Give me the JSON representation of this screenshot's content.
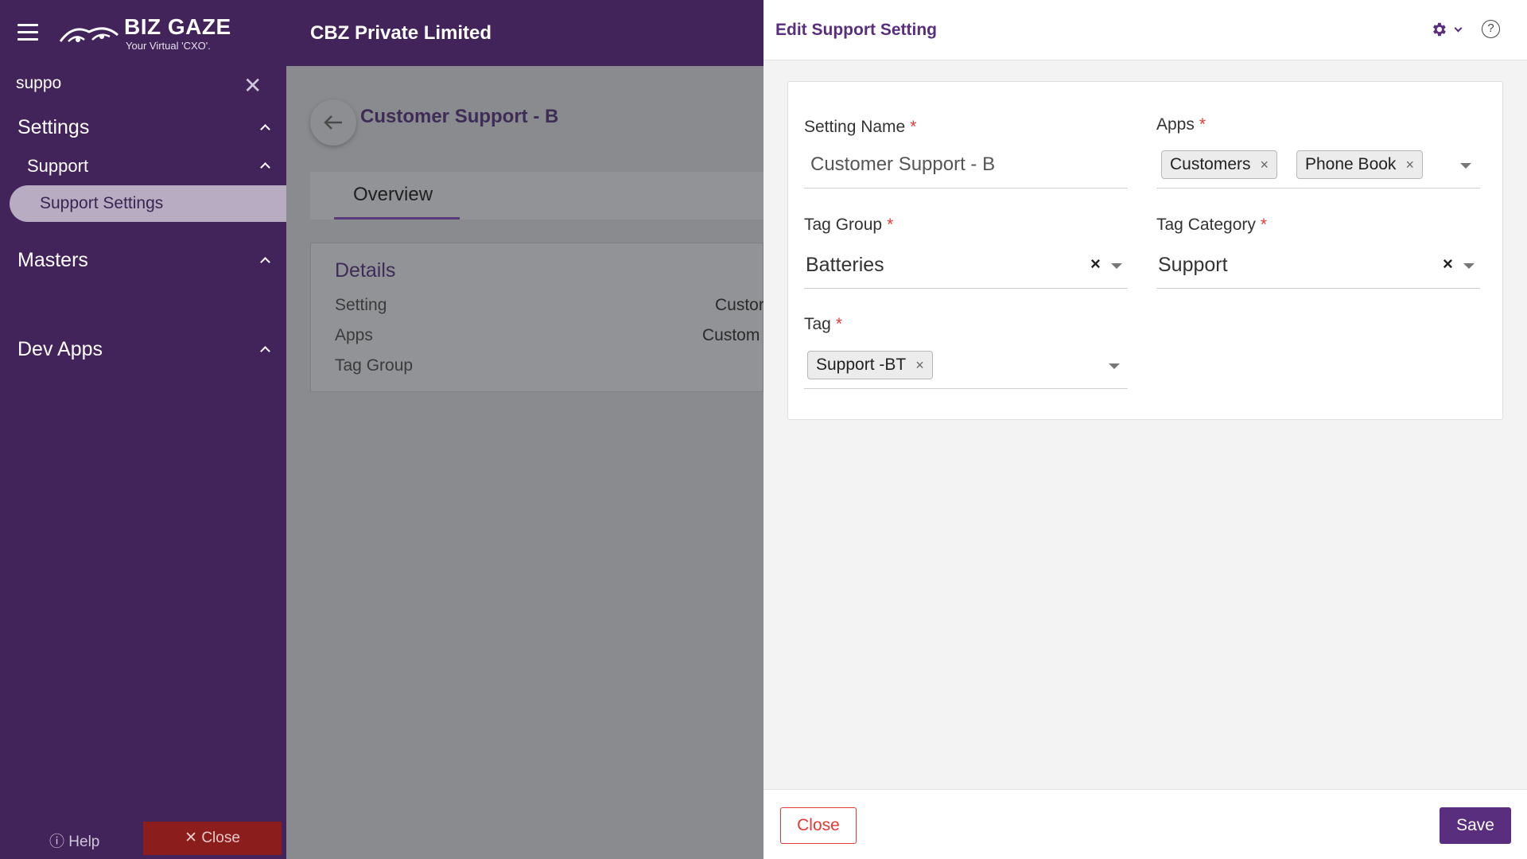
{
  "header": {
    "logo_text": "BIZ GAZE",
    "logo_tagline": "Your Virtual 'CXO'.",
    "company": "CBZ Private Limited"
  },
  "sidebar": {
    "search_value": "suppo",
    "items": [
      {
        "label": "Settings"
      },
      {
        "label": "Support"
      },
      {
        "label": "Support Settings"
      },
      {
        "label": "Masters"
      },
      {
        "label": "Dev Apps"
      }
    ],
    "help_label": "Help",
    "close_label": "Close"
  },
  "main": {
    "title": "Customer Support - B",
    "tab_label": "Overview",
    "details_title": "Details",
    "rows": [
      {
        "label": "Setting",
        "value": "Custor"
      },
      {
        "label": "Apps",
        "value": "Custom"
      },
      {
        "label": "Tag Group",
        "value": ""
      }
    ]
  },
  "panel": {
    "title": "Edit Support Setting",
    "setting_name_label": "Setting Name",
    "setting_name_value": "Customer Support - B",
    "apps_label": "Apps",
    "apps_chips": [
      "Customers",
      "Phone Book"
    ],
    "tag_group_label": "Tag Group",
    "tag_group_value": "Batteries",
    "tag_category_label": "Tag Category",
    "tag_category_value": "Support",
    "tag_label": "Tag",
    "tag_chips": [
      "Support -BT"
    ],
    "required_mark": "*",
    "chip_remove": "×",
    "clear_mark": "×",
    "close_label": "Close",
    "save_label": "Save",
    "help_mark": "?"
  },
  "colors": {
    "brand": "#42235a",
    "accent": "#5a2e7e",
    "danger": "#e53935"
  },
  "icons": [
    "menu-icon",
    "logo",
    "close-icon",
    "chevron-up-icon",
    "arrow-left-icon",
    "gear-icon",
    "chevron-down-icon",
    "help-icon",
    "clear-icon",
    "dropdown-caret-icon"
  ]
}
